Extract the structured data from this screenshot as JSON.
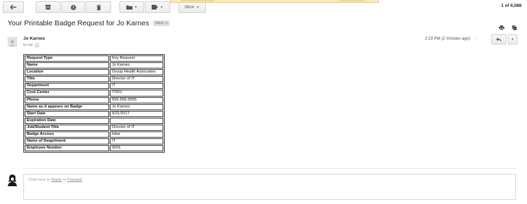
{
  "toolbar": {
    "more_label": "More",
    "message_count": "1 of 6,088"
  },
  "subject": {
    "title": "Your Printable Badge Request for Jo Karnes",
    "label": "Inbox"
  },
  "message": {
    "sender": "Jo Karnes",
    "to": "to me",
    "timestamp": "2:29 PM (2 minutes ago)"
  },
  "table": {
    "rows": [
      {
        "label": "Request Type",
        "value": "Key Request"
      },
      {
        "label": "Name",
        "value": "Jo Karnes"
      },
      {
        "label": "Location",
        "value": "Group Health Associates"
      },
      {
        "label": "Title",
        "value": "Director of IT"
      },
      {
        "label": "Department",
        "value": "IT"
      },
      {
        "label": "Cost Center",
        "value": "IT001"
      },
      {
        "label": "Phone",
        "value": "555-555-5555"
      },
      {
        "label": "Name as it appears on Badge",
        "value": "Jo Karnes"
      },
      {
        "label": "Start Date",
        "value": "9/21/2017"
      },
      {
        "label": "Expiration Date",
        "value": ""
      },
      {
        "label": "Job/Student Title",
        "value": "Director of IT"
      },
      {
        "label": "Badge Access",
        "value": "false"
      },
      {
        "label": "Name of Deaprtment",
        "value": "IT"
      },
      {
        "label": "Employee Number",
        "value": "0001"
      }
    ]
  },
  "reply": {
    "prefix": "Click here to",
    "reply_link": "Reply",
    "or": "or",
    "forward_link": "Forward"
  },
  "icons": {
    "back": "back-arrow-icon",
    "archive": "archive-icon",
    "spam": "report-spam-icon",
    "delete": "trash-icon",
    "move": "folder-icon",
    "labels": "label-icon",
    "print": "print-icon",
    "new_window": "new-window-icon",
    "star": "star-icon",
    "reply": "reply-icon"
  }
}
